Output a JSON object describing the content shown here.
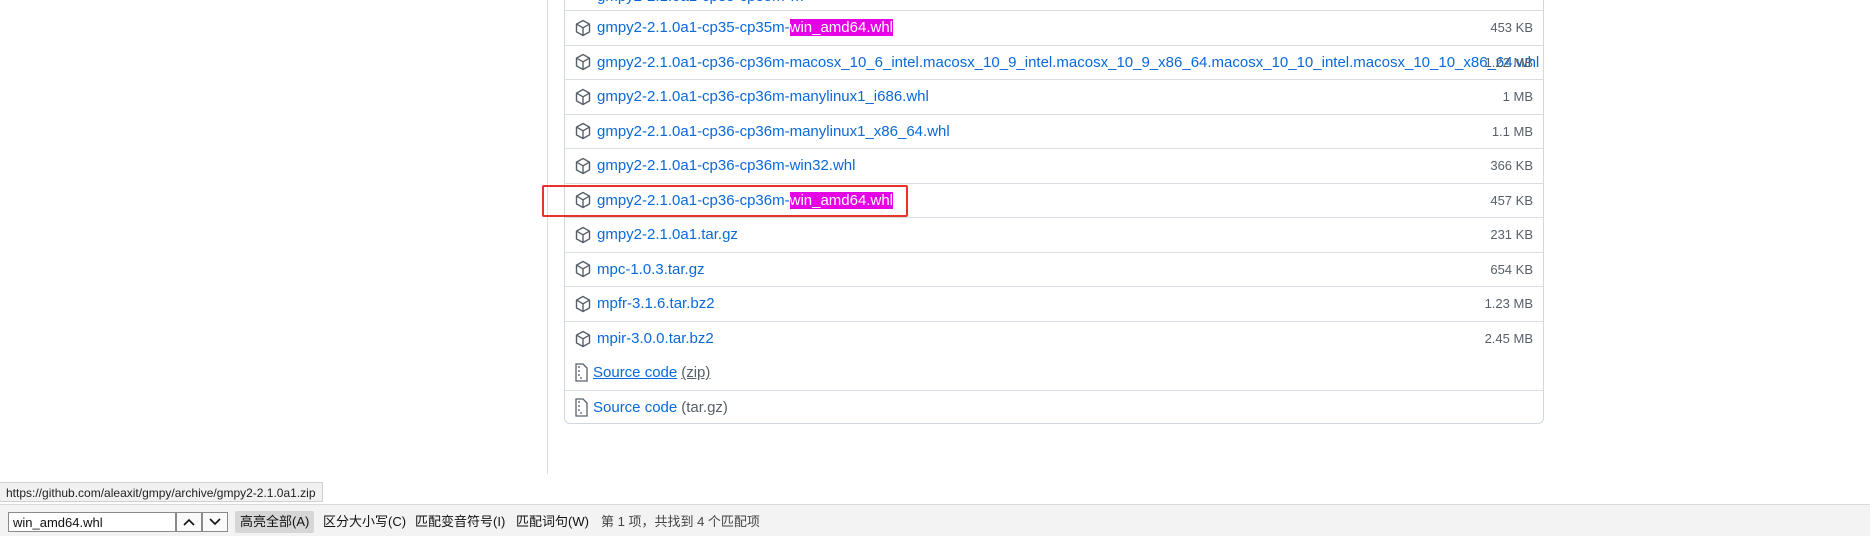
{
  "assets": {
    "rows": [
      {
        "prefix": "gmpy2-2.1.0a1-cp35-cp35m-",
        "highlight": "win_amd64.whl",
        "size": "453 KB"
      },
      {
        "prefix": "gmpy2-2.1.0a1-cp36-cp36m-macosx_10_6_intel.macosx_10_9_intel.macosx_10_9_x86_64.macosx_10_10_intel.macosx_10_10_x86_64.whl",
        "highlight": "",
        "size": "1.22 MB"
      },
      {
        "prefix": "gmpy2-2.1.0a1-cp36-cp36m-manylinux1_i686.whl",
        "highlight": "",
        "size": "1 MB"
      },
      {
        "prefix": "gmpy2-2.1.0a1-cp36-cp36m-manylinux1_x86_64.whl",
        "highlight": "",
        "size": "1.1 MB"
      },
      {
        "prefix": "gmpy2-2.1.0a1-cp36-cp36m-win32.whl",
        "highlight": "",
        "size": "366 KB"
      },
      {
        "prefix": "gmpy2-2.1.0a1-cp36-cp36m-",
        "highlight": "win_amd64.whl",
        "size": "457 KB"
      },
      {
        "prefix": "gmpy2-2.1.0a1.tar.gz",
        "highlight": "",
        "size": "231 KB"
      },
      {
        "prefix": "mpc-1.0.3.tar.gz",
        "highlight": "",
        "size": "654 KB"
      },
      {
        "prefix": "mpfr-3.1.6.tar.bz2",
        "highlight": "",
        "size": "1.23 MB"
      },
      {
        "prefix": "mpir-3.0.0.tar.bz2",
        "highlight": "",
        "size": "2.45 MB"
      }
    ],
    "source_zip": {
      "label": "Source code",
      "suffix": "(zip)"
    },
    "source_targz": {
      "label": "Source code",
      "suffix": "(tar.gz)"
    }
  },
  "status_url": "https://github.com/aleaxit/gmpy/archive/gmpy2-2.1.0a1.zip",
  "findbar": {
    "query": "win_amd64.whl",
    "highlight_all": "高亮全部(A)",
    "match_case": "区分大小写(C)",
    "match_diacritics": "匹配变音符号(I)",
    "whole_words": "匹配词句(W)",
    "result": "第 1 项，共找到 4 个匹配项"
  },
  "colors": {
    "link": "#0969da",
    "find_highlight": "#e600e6",
    "callout": "#e5352b"
  }
}
